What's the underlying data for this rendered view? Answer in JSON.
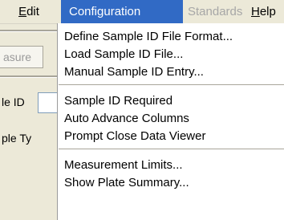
{
  "menubar": {
    "edit": {
      "label_prefix": "",
      "label_underlined": "E",
      "label_rest": "dit"
    },
    "configuration": {
      "label": "Configuration"
    },
    "standards": {
      "label": "Standards"
    },
    "help": {
      "label_underlined": "H",
      "label_rest": "elp"
    }
  },
  "background": {
    "tab_label": "asure",
    "label_1": "le ID",
    "label_2": "ple Ty"
  },
  "configuration_menu": {
    "groups": [
      [
        "Define Sample ID File Format...",
        "Load Sample ID File...",
        "Manual Sample ID Entry..."
      ],
      [
        "Sample ID Required",
        "Auto Advance Columns",
        "Prompt Close Data Viewer"
      ],
      [
        "Measurement Limits...",
        "Show Plate Summary..."
      ]
    ]
  },
  "colors": {
    "highlight": "#316ac5",
    "menubar_bg": "#ece9d8",
    "disabled_text": "#a7a7a7"
  }
}
